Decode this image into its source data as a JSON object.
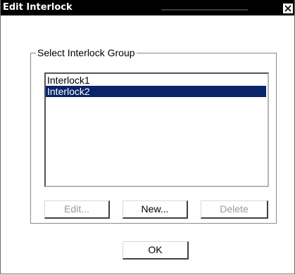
{
  "window": {
    "title": "Edit Interlock",
    "close_glyph": "✕"
  },
  "group": {
    "label": "Select Interlock Group",
    "items": [
      {
        "label": "Interlock1",
        "selected": false
      },
      {
        "label": "Interlock2",
        "selected": true
      }
    ]
  },
  "buttons": {
    "edit_label": "Edit...",
    "new_label": "New...",
    "delete_label": "Delete",
    "ok_label": "OK"
  },
  "colors": {
    "titlebar": "#000000",
    "selection": "#0a246a",
    "disabled_text": "#9a9a9a"
  }
}
